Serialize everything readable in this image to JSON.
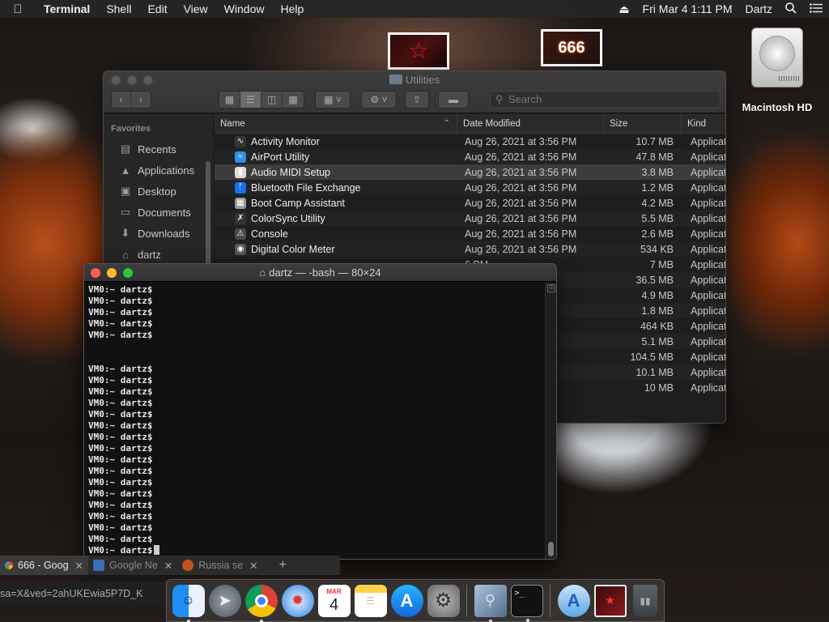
{
  "menubar": {
    "app": "Terminal",
    "menus": [
      "Shell",
      "Edit",
      "View",
      "Window",
      "Help"
    ],
    "datetime": "Fri Mar 4  1:11 PM",
    "user": "Dartz"
  },
  "desktop": {
    "hd_label": "Macintosh HD",
    "thumb2_text": "666"
  },
  "finder": {
    "title": "Utilities",
    "search_placeholder": "Search",
    "sidebar": {
      "header": "Favorites",
      "items": [
        "Recents",
        "Applications",
        "Desktop",
        "Documents",
        "Downloads",
        "dartz"
      ]
    },
    "columns": [
      "Name",
      "Date Modified",
      "Size",
      "Kind"
    ],
    "rows": [
      {
        "name": "Activity Monitor",
        "date": "Aug 26, 2021 at 3:56 PM",
        "size": "10.7 MB",
        "kind": "Applicat"
      },
      {
        "name": "AirPort Utility",
        "date": "Aug 26, 2021 at 3:56 PM",
        "size": "47.8 MB",
        "kind": "Applicat"
      },
      {
        "name": "Audio MIDI Setup",
        "date": "Aug 26, 2021 at 3:56 PM",
        "size": "3.8 MB",
        "kind": "Applicat"
      },
      {
        "name": "Bluetooth File Exchange",
        "date": "Aug 26, 2021 at 3:56 PM",
        "size": "1.2 MB",
        "kind": "Applicat"
      },
      {
        "name": "Boot Camp Assistant",
        "date": "Aug 26, 2021 at 3:56 PM",
        "size": "4.2 MB",
        "kind": "Applicat"
      },
      {
        "name": "ColorSync Utility",
        "date": "Aug 26, 2021 at 3:56 PM",
        "size": "5.5 MB",
        "kind": "Applicat"
      },
      {
        "name": "Console",
        "date": "Aug 26, 2021 at 3:56 PM",
        "size": "2.6 MB",
        "kind": "Applicat"
      },
      {
        "name": "Digital Color Meter",
        "date": "Aug 26, 2021 at 3:56 PM",
        "size": "534 KB",
        "kind": "Applicat"
      },
      {
        "name": "",
        "date": "6 PM",
        "size": "7 MB",
        "kind": "Applicat"
      },
      {
        "name": "",
        "date": "6 PM",
        "size": "36.5 MB",
        "kind": "Applicat"
      },
      {
        "name": "",
        "date": "6 PM",
        "size": "4.9 MB",
        "kind": "Applicat"
      },
      {
        "name": "",
        "date": "6 PM",
        "size": "1.8 MB",
        "kind": "Applicat"
      },
      {
        "name": "",
        "date": "6 PM",
        "size": "464 KB",
        "kind": "Applicat"
      },
      {
        "name": "",
        "date": "6 PM",
        "size": "5.1 MB",
        "kind": "Applicat"
      },
      {
        "name": "",
        "date": "6 PM",
        "size": "104.5 MB",
        "kind": "Applicat"
      },
      {
        "name": "",
        "date": "6 PM",
        "size": "10.1 MB",
        "kind": "Applicat"
      },
      {
        "name": "",
        "date": "6 PM",
        "size": "10 MB",
        "kind": "Applicat"
      }
    ]
  },
  "terminal": {
    "title": "dartz — -bash — 80×24",
    "prompt": "VM0:~ dartz$"
  },
  "chrome": {
    "tabs": [
      "666 - Goog",
      "Google Ne",
      "Russia se"
    ],
    "url": "sa=X&ved=2ahUKEwia5P7D_K"
  },
  "dock": {
    "calendar_month": "MAR",
    "calendar_day": "4",
    "terminal_glyph": ">_"
  }
}
